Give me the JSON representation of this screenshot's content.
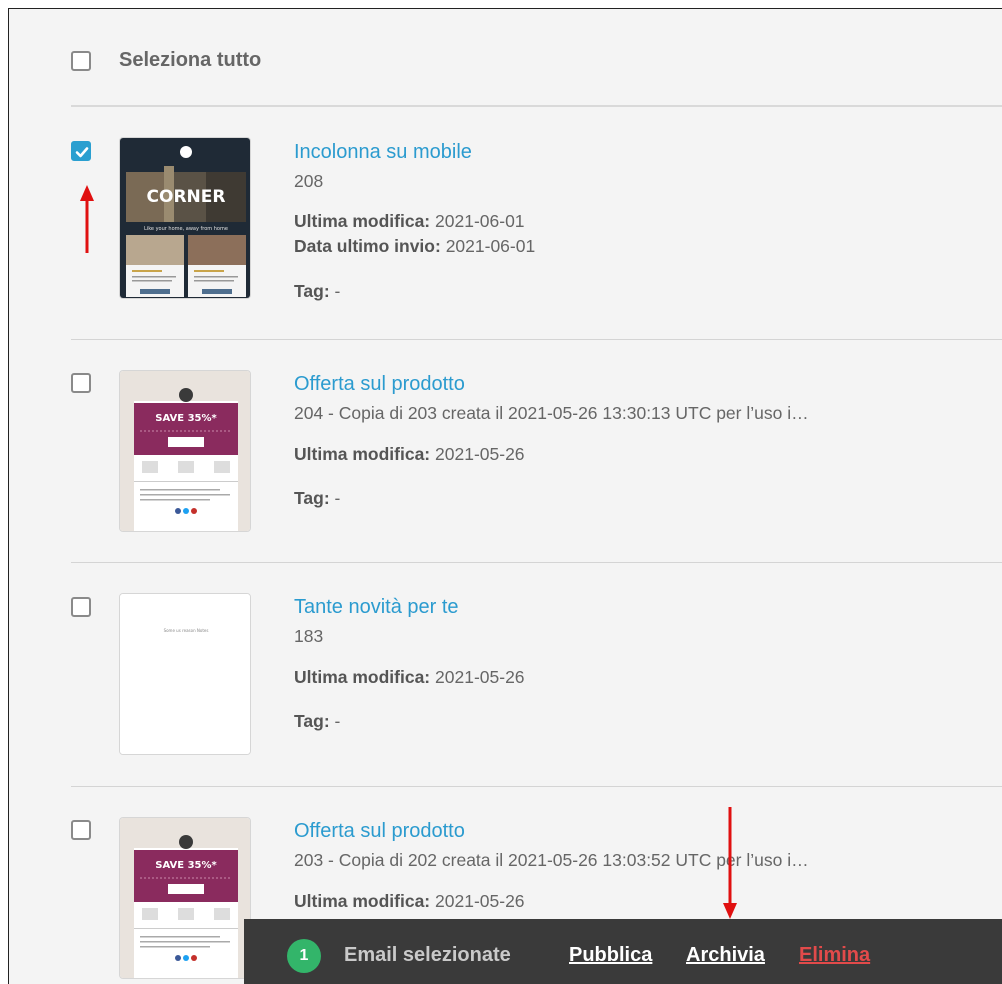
{
  "select_all_label": "Seleziona tutto",
  "emails": [
    {
      "title": "Incolonna su mobile",
      "subtitle": "208",
      "meta": [
        {
          "label": "Ultima modifica:",
          "value": "2021-06-01"
        },
        {
          "label": "Data ultimo invio:",
          "value": "2021-06-01"
        }
      ],
      "tag_label": "Tag:",
      "tag_value": "-",
      "checked": true,
      "thumb_text": {
        "title": "CORNER",
        "tagline": "Like your home, away from home"
      }
    },
    {
      "title": "Offerta sul prodotto",
      "subtitle": "204 - Copia di 203 creata il 2021-05-26 13:30:13 UTC per l’uso i…",
      "meta": [
        {
          "label": "Ultima modifica:",
          "value": "2021-05-26"
        }
      ],
      "tag_label": "Tag:",
      "tag_value": "-",
      "checked": false,
      "thumb_text": {
        "title": "SAVE 35%*"
      }
    },
    {
      "title": "Tante novità per te",
      "subtitle": "183",
      "meta": [
        {
          "label": "Ultima modifica:",
          "value": "2021-05-26"
        }
      ],
      "tag_label": "Tag:",
      "tag_value": "-",
      "checked": false,
      "thumb_text": {
        "title": "Some us reason Notes"
      }
    },
    {
      "title": "Offerta sul prodotto",
      "subtitle": "203 - Copia di 202 creata il 2021-05-26 13:03:52 UTC per l’uso i…",
      "meta": [
        {
          "label": "Ultima modifica:",
          "value": "2021-05-26"
        }
      ],
      "checked": false,
      "thumb_text": {
        "title": "SAVE 35%*"
      }
    }
  ],
  "action_bar": {
    "count": "1",
    "selected_label": "Email selezionate",
    "publish": "Pubblica",
    "archive": "Archivia",
    "delete": "Elimina"
  },
  "colors": {
    "accent": "#2b9bcf",
    "checkbox_checked": "#2a9fd0",
    "badge": "#33b56a",
    "delete": "#e24a4a",
    "annotation_arrow": "#e01010"
  }
}
